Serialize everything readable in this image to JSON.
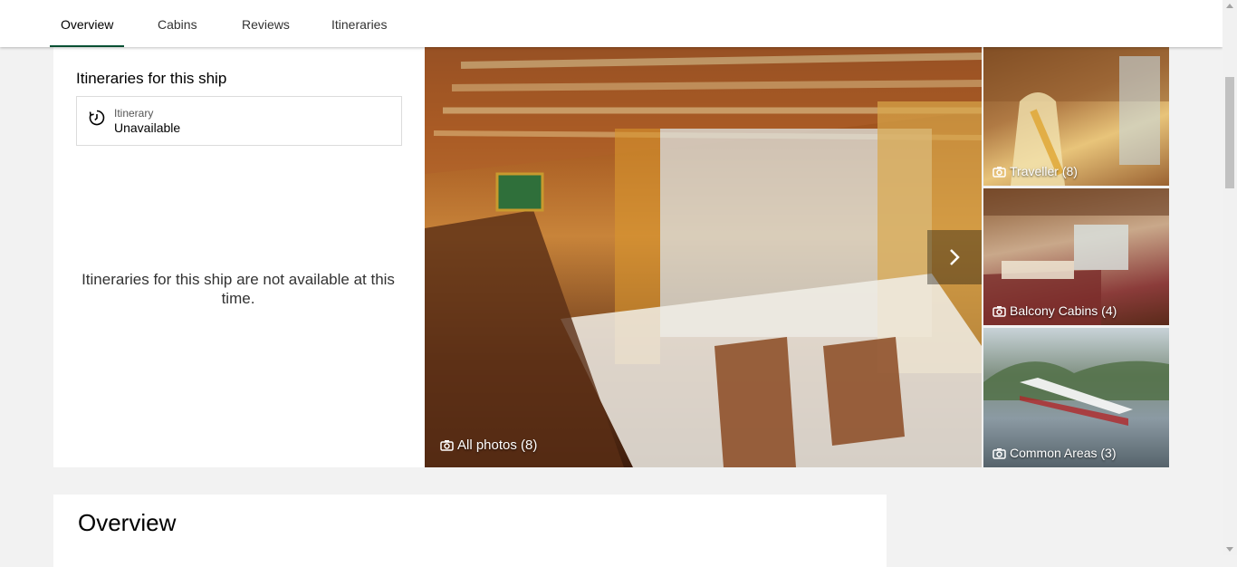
{
  "nav": {
    "tabs": [
      {
        "label": "Overview",
        "active": true
      },
      {
        "label": "Cabins",
        "active": false
      },
      {
        "label": "Reviews",
        "active": false
      },
      {
        "label": "Itineraries",
        "active": false
      }
    ]
  },
  "itineraries": {
    "title": "Itineraries for this ship",
    "box_label": "Itinerary",
    "box_value": "Unavailable",
    "message": "Itineraries for this ship are not available at this time."
  },
  "photos": {
    "main_label": "All photos (8)",
    "thumbnails": [
      {
        "label": "Traveller (8)"
      },
      {
        "label": "Balcony Cabins (4)"
      },
      {
        "label": "Common Areas (3)"
      }
    ]
  },
  "overview": {
    "title": "Overview"
  },
  "colors": {
    "active_tab_underline": "#004f32",
    "page_background": "#f2f2f2"
  }
}
